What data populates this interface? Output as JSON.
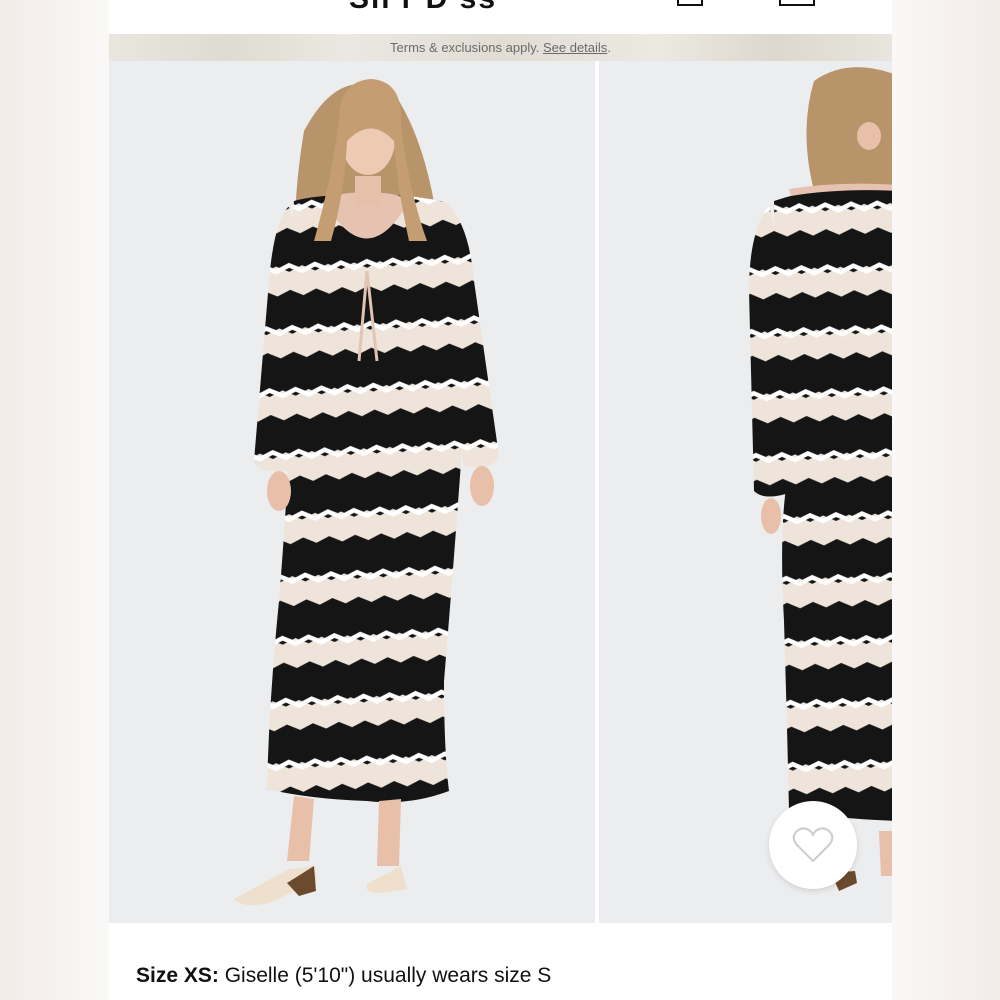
{
  "header": {
    "title_fragment": "Sh  r   D  ss",
    "icons": [
      "bag-icon",
      "account-icon"
    ]
  },
  "banner": {
    "text": "Terms & exclusions apply. ",
    "link": "See details",
    "suffix": "."
  },
  "gallery": {
    "images": [
      {
        "name": "front-view",
        "alt": "Model wearing black and cream zigzag striped crochet maxi dress, front view"
      },
      {
        "name": "back-view",
        "alt": "Model wearing black and cream zigzag striped crochet maxi dress, back view"
      }
    ],
    "favorite_icon": "heart-icon"
  },
  "size_info": {
    "label": "Size XS:",
    "text": " Giselle (5'10\") usually wears size S"
  },
  "colors": {
    "stripe_dark": "#151515",
    "stripe_light": "#efe4da",
    "background": "#ecedee"
  }
}
